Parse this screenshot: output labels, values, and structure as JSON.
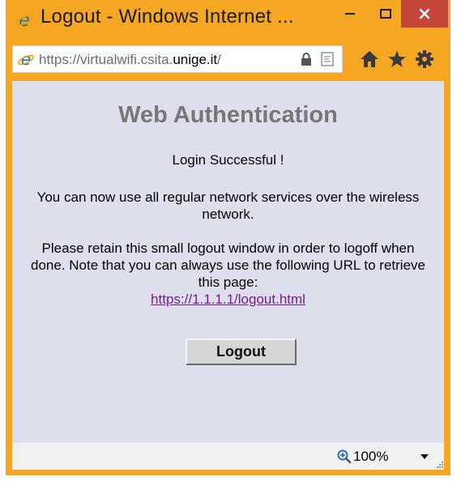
{
  "window": {
    "title": "Logout - Windows Internet ..."
  },
  "address": {
    "url_scheme": "https://virtualwifi.csita.",
    "url_host": "unige.it",
    "url_rest": "/"
  },
  "page": {
    "heading": "Web Authentication",
    "status": "Login Successful !",
    "info": "You can now use all regular network services over the wireless network.",
    "retain": "Please retain this small logout window in order to logoff when done. Note that you can always use the following URL to retrieve this page:",
    "logout_link": "https://1.1.1.1/logout.html",
    "logout_button": "Logout"
  },
  "status_bar": {
    "zoom": "100%"
  },
  "colors": {
    "frame": "#f5a622",
    "close": "#c7463c",
    "content_bg": "#dde0ec",
    "link": "#7a1a8c"
  },
  "icons": [
    "ie-icon",
    "minimize-icon",
    "maximize-icon",
    "close-icon",
    "lock-icon",
    "compat-view-icon",
    "home-icon",
    "favorites-star-icon",
    "settings-gear-icon",
    "zoom-icon",
    "chevron-down-icon",
    "resize-grip-icon"
  ]
}
